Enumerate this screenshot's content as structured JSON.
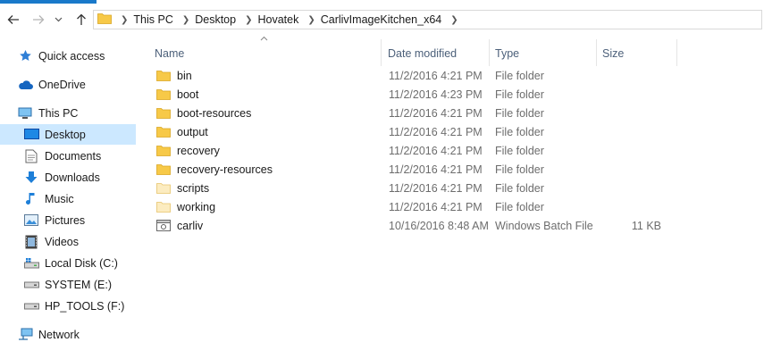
{
  "breadcrumbs": [
    "This PC",
    "Desktop",
    "Hovatek",
    "CarlivImageKitchen_x64"
  ],
  "nav": [
    {
      "label": "Quick access",
      "icon": "star-icon"
    },
    {
      "label": "OneDrive",
      "icon": "cloud-icon"
    },
    {
      "label": "This PC",
      "icon": "computer-icon"
    },
    {
      "label": "Desktop",
      "icon": "desktop-icon",
      "selected": true
    },
    {
      "label": "Documents",
      "icon": "documents-icon"
    },
    {
      "label": "Downloads",
      "icon": "download-arrow-icon"
    },
    {
      "label": "Music",
      "icon": "music-note-icon"
    },
    {
      "label": "Pictures",
      "icon": "pictures-icon"
    },
    {
      "label": "Videos",
      "icon": "film-icon"
    },
    {
      "label": "Local Disk (C:)",
      "icon": "drive-windows-icon"
    },
    {
      "label": "SYSTEM (E:)",
      "icon": "drive-icon"
    },
    {
      "label": "HP_TOOLS (F:)",
      "icon": "drive-icon"
    },
    {
      "label": "Network",
      "icon": "network-icon"
    }
  ],
  "columns": {
    "name": "Name",
    "date": "Date modified",
    "type": "Type",
    "size": "Size"
  },
  "files": [
    {
      "name": "bin",
      "date": "11/2/2016 4:21 PM",
      "type": "File folder",
      "size": "",
      "icon": "folder-icon"
    },
    {
      "name": "boot",
      "date": "11/2/2016 4:23 PM",
      "type": "File folder",
      "size": "",
      "icon": "folder-icon"
    },
    {
      "name": "boot-resources",
      "date": "11/2/2016 4:21 PM",
      "type": "File folder",
      "size": "",
      "icon": "folder-icon"
    },
    {
      "name": "output",
      "date": "11/2/2016 4:21 PM",
      "type": "File folder",
      "size": "",
      "icon": "folder-icon"
    },
    {
      "name": "recovery",
      "date": "11/2/2016 4:21 PM",
      "type": "File folder",
      "size": "",
      "icon": "folder-icon"
    },
    {
      "name": "recovery-resources",
      "date": "11/2/2016 4:21 PM",
      "type": "File folder",
      "size": "",
      "icon": "folder-icon"
    },
    {
      "name": "scripts",
      "date": "11/2/2016 4:21 PM",
      "type": "File folder",
      "size": "",
      "icon": "empty-folder-icon"
    },
    {
      "name": "working",
      "date": "11/2/2016 4:21 PM",
      "type": "File folder",
      "size": "",
      "icon": "empty-folder-icon"
    },
    {
      "name": "carliv",
      "date": "10/16/2016 8:48 AM",
      "type": "Windows Batch File",
      "size": "11 KB",
      "icon": "batch-file-icon"
    }
  ],
  "colors": {
    "accent": "#1979ca",
    "selected": "#cce8ff",
    "folder": "#f7c948",
    "header_text": "#4c607a"
  }
}
